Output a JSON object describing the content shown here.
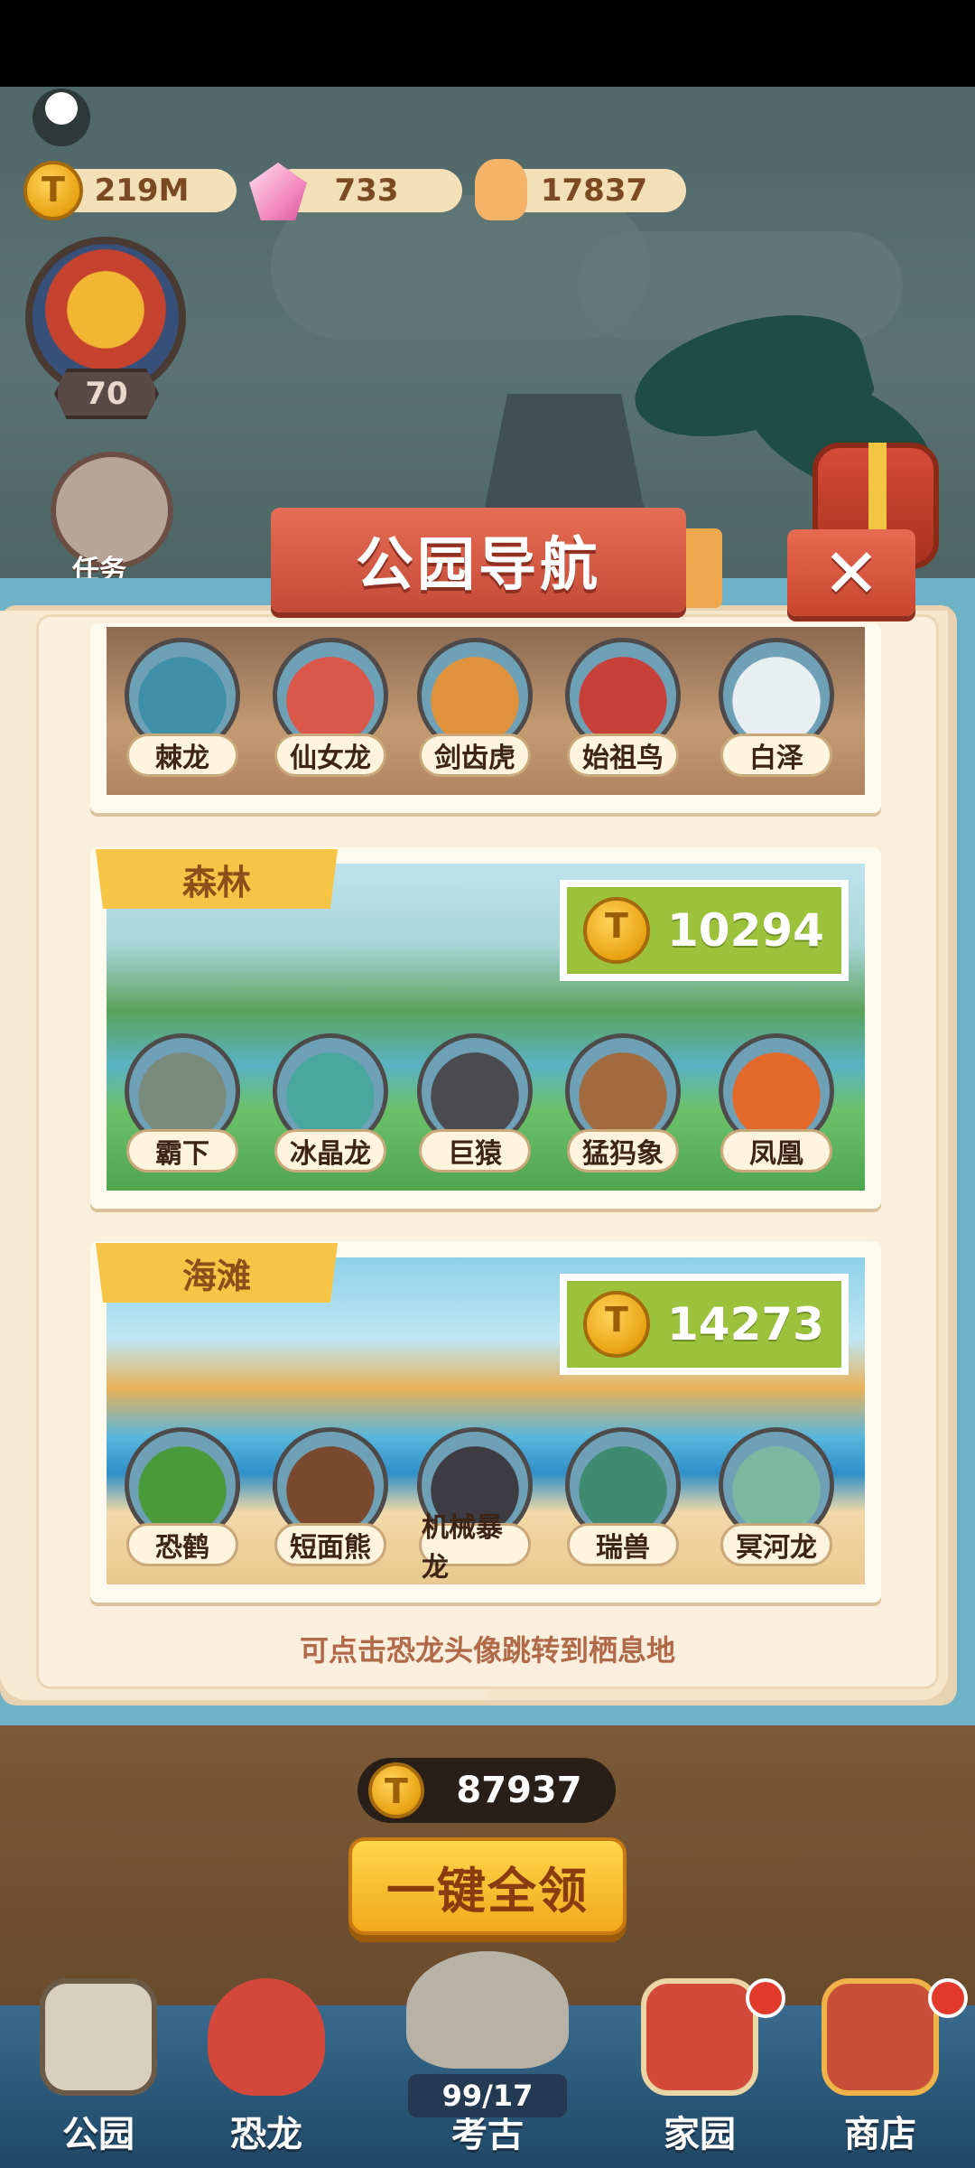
{
  "hud": {
    "gold": "219M",
    "gems": "733",
    "likes": "17837",
    "level": "70",
    "task_label": "任务"
  },
  "dialog": {
    "title": "公园导航",
    "close_symbol": "✕",
    "hint": "可点击恐龙头像跳转到栖息地",
    "parks": [
      {
        "tag": "",
        "price": "",
        "dinos": [
          "棘龙",
          "仙女龙",
          "剑齿虎",
          "始祖鸟",
          "白泽"
        ],
        "dino_colors": [
          "#3f8fa8",
          "#d9584a",
          "#e0913c",
          "#c8403a",
          "#e9eef0"
        ]
      },
      {
        "tag": "森林",
        "price": "10294",
        "dinos": [
          "霸下",
          "冰晶龙",
          "巨猿",
          "猛犸象",
          "凤凰"
        ],
        "dino_colors": [
          "#7a8a7d",
          "#4aa7a0",
          "#4a4a4f",
          "#a26b3f",
          "#e46a2c"
        ]
      },
      {
        "tag": "海滩",
        "price": "14273",
        "dinos": [
          "恐鹤",
          "短面熊",
          "机械暴龙",
          "瑞兽",
          "冥河龙"
        ],
        "dino_colors": [
          "#4a9a3c",
          "#7a4a2e",
          "#3c3c42",
          "#3f8a70",
          "#7ab8a0"
        ]
      }
    ]
  },
  "bottom": {
    "gold_total": "87937",
    "collect_all": "一键全领",
    "dig_counter": "99/17"
  },
  "nav": [
    {
      "label": "公园",
      "badge": false
    },
    {
      "label": "恐龙",
      "badge": false
    },
    {
      "label": "考古",
      "badge": false
    },
    {
      "label": "家园",
      "badge": true
    },
    {
      "label": "商店",
      "badge": true
    }
  ],
  "colors": {
    "dialog_frame": "#6fb1c7",
    "ribbon": "#d65a43",
    "price_green": "#9cc23c",
    "tag_yellow": "#f7c545"
  }
}
